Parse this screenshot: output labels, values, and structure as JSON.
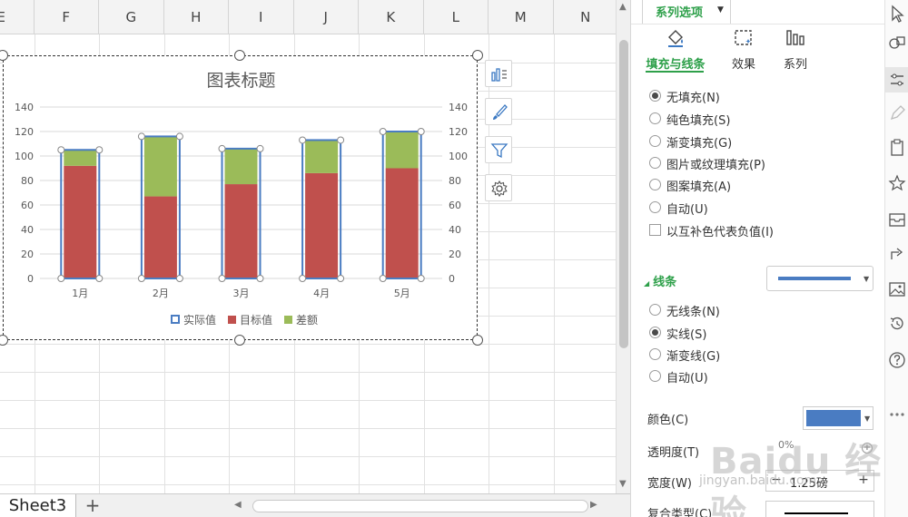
{
  "sheet": {
    "columns": [
      "E",
      "F",
      "G",
      "H",
      "I",
      "J",
      "K",
      "L",
      "M",
      "N"
    ],
    "active_tab": "Sheet3",
    "add_tab_label": "+"
  },
  "chart": {
    "title": "图表标题",
    "tools": [
      "chart-elements-icon",
      "chart-style-icon",
      "chart-filter-icon",
      "chart-settings-icon"
    ]
  },
  "chart_data": {
    "type": "bar",
    "title": "图表标题",
    "categories": [
      "1月",
      "2月",
      "3月",
      "4月",
      "5月"
    ],
    "series": [
      {
        "name": "实际值",
        "values": [
          105,
          116,
          106,
          113,
          120
        ],
        "style": "outline",
        "color": "#4a7cc2"
      },
      {
        "name": "目标值",
        "values": [
          92,
          67,
          77,
          86,
          90
        ],
        "style": "stacked",
        "color": "#c0504d"
      },
      {
        "name": "差额",
        "values": [
          13,
          49,
          29,
          27,
          30
        ],
        "style": "stacked",
        "color": "#9bbb59"
      }
    ],
    "ylim": [
      0,
      140
    ],
    "yticks": [
      "0",
      "20",
      "40",
      "60",
      "80",
      "100",
      "120",
      "140"
    ],
    "secondary_yticks": [
      "0",
      "20",
      "40",
      "60",
      "80",
      "100",
      "120",
      "140"
    ],
    "grid": true,
    "legend": "bottom"
  },
  "pane": {
    "header": "系列选项",
    "tabs": [
      {
        "label": "填充与线条",
        "icon": "fill-bucket-icon"
      },
      {
        "label": "效果",
        "icon": "effects-icon"
      },
      {
        "label": "系列",
        "icon": "series-icon"
      }
    ],
    "fill_options": [
      {
        "label": "无填充(N)",
        "checked": true
      },
      {
        "label": "纯色填充(S)",
        "checked": false
      },
      {
        "label": "渐变填充(G)",
        "checked": false
      },
      {
        "label": "图片或纹理填充(P)",
        "checked": false
      },
      {
        "label": "图案填充(A)",
        "checked": false
      },
      {
        "label": "自动(U)",
        "checked": false
      }
    ],
    "invert_negative": "以互补色代表负值(I)",
    "line_section": "线条",
    "line_options": [
      {
        "label": "无线条(N)",
        "checked": false
      },
      {
        "label": "实线(S)",
        "checked": true
      },
      {
        "label": "渐变线(G)",
        "checked": false
      },
      {
        "label": "自动(U)",
        "checked": false
      }
    ],
    "color_label": "颜色(C)",
    "line_color": "#4a7cc2",
    "transparency_label": "透明度(T)",
    "transparency_value": "0%",
    "width_label": "宽度(W)",
    "width_value": "1.25磅",
    "compound_label": "复合类型(C)"
  },
  "watermark": {
    "brand": "Baidu 经验",
    "url": "jingyan.baidu.com"
  }
}
